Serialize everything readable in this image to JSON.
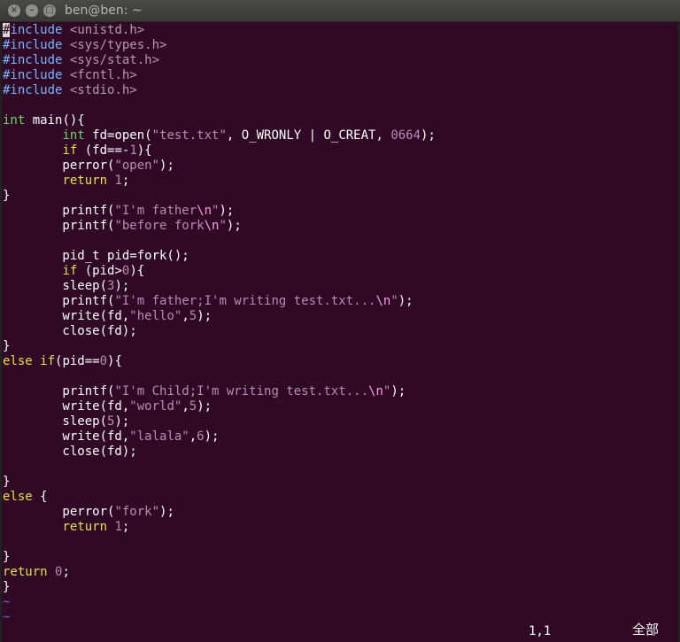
{
  "window": {
    "title": "ben@ben: ~",
    "close_glyph": "×",
    "minimize_glyph": "–",
    "maximize_glyph": "□"
  },
  "editor": {
    "lines": [
      [
        {
          "t": "#",
          "c": "cursor"
        },
        {
          "t": "include",
          "c": "pp"
        },
        {
          "t": " "
        },
        {
          "t": "<unistd.h>",
          "c": "hdr"
        }
      ],
      [
        {
          "t": "#include",
          "c": "pp"
        },
        {
          "t": " "
        },
        {
          "t": "<sys/types.h>",
          "c": "hdr"
        }
      ],
      [
        {
          "t": "#include",
          "c": "pp"
        },
        {
          "t": " "
        },
        {
          "t": "<sys/stat.h>",
          "c": "hdr"
        }
      ],
      [
        {
          "t": "#include",
          "c": "pp"
        },
        {
          "t": " "
        },
        {
          "t": "<fcntl.h>",
          "c": "hdr"
        }
      ],
      [
        {
          "t": "#include",
          "c": "pp"
        },
        {
          "t": " "
        },
        {
          "t": "<stdio.h>",
          "c": "hdr"
        }
      ],
      [],
      [
        {
          "t": "int",
          "c": "ty"
        },
        {
          "t": " main(){"
        }
      ],
      [
        {
          "t": "        "
        },
        {
          "t": "int",
          "c": "ty"
        },
        {
          "t": " fd=open("
        },
        {
          "t": "\"test.txt\"",
          "c": "str"
        },
        {
          "t": ", O_WRONLY | O_CREAT, "
        },
        {
          "t": "0664",
          "c": "num"
        },
        {
          "t": ");"
        }
      ],
      [
        {
          "t": "        "
        },
        {
          "t": "if",
          "c": "kw"
        },
        {
          "t": " (fd==-"
        },
        {
          "t": "1",
          "c": "num"
        },
        {
          "t": "){"
        }
      ],
      [
        {
          "t": "        perror("
        },
        {
          "t": "\"open\"",
          "c": "str"
        },
        {
          "t": ");"
        }
      ],
      [
        {
          "t": "        "
        },
        {
          "t": "return",
          "c": "kw"
        },
        {
          "t": " "
        },
        {
          "t": "1",
          "c": "num"
        },
        {
          "t": ";"
        }
      ],
      [
        {
          "t": "}"
        }
      ],
      [
        {
          "t": "        printf("
        },
        {
          "t": "\"I'm father",
          "c": "str"
        },
        {
          "t": "\\n",
          "c": "esc"
        },
        {
          "t": "\"",
          "c": "str"
        },
        {
          "t": ");"
        }
      ],
      [
        {
          "t": "        printf("
        },
        {
          "t": "\"before fork",
          "c": "str"
        },
        {
          "t": "\\n",
          "c": "esc"
        },
        {
          "t": "\"",
          "c": "str"
        },
        {
          "t": ");"
        }
      ],
      [],
      [
        {
          "t": "        pid_t pid=fork();"
        }
      ],
      [
        {
          "t": "        "
        },
        {
          "t": "if",
          "c": "kw"
        },
        {
          "t": " (pid>"
        },
        {
          "t": "0",
          "c": "num"
        },
        {
          "t": "){"
        }
      ],
      [
        {
          "t": "        sleep("
        },
        {
          "t": "3",
          "c": "num"
        },
        {
          "t": ");"
        }
      ],
      [
        {
          "t": "        printf("
        },
        {
          "t": "\"I'm father;I'm writing test.txt...",
          "c": "str"
        },
        {
          "t": "\\n",
          "c": "esc"
        },
        {
          "t": "\"",
          "c": "str"
        },
        {
          "t": ");"
        }
      ],
      [
        {
          "t": "        write(fd,"
        },
        {
          "t": "\"hello\"",
          "c": "str"
        },
        {
          "t": ","
        },
        {
          "t": "5",
          "c": "num"
        },
        {
          "t": ");"
        }
      ],
      [
        {
          "t": "        close(fd);"
        }
      ],
      [
        {
          "t": "}"
        }
      ],
      [
        {
          "t": "else",
          "c": "kw"
        },
        {
          "t": " "
        },
        {
          "t": "if",
          "c": "kw"
        },
        {
          "t": "(pid=="
        },
        {
          "t": "0",
          "c": "num"
        },
        {
          "t": "){"
        }
      ],
      [],
      [
        {
          "t": "        printf("
        },
        {
          "t": "\"I'm Child;I'm writing test.txt...",
          "c": "str"
        },
        {
          "t": "\\n",
          "c": "esc"
        },
        {
          "t": "\"",
          "c": "str"
        },
        {
          "t": ");"
        }
      ],
      [
        {
          "t": "        write(fd,"
        },
        {
          "t": "\"world\"",
          "c": "str"
        },
        {
          "t": ","
        },
        {
          "t": "5",
          "c": "num"
        },
        {
          "t": ");"
        }
      ],
      [
        {
          "t": "        sleep("
        },
        {
          "t": "5",
          "c": "num"
        },
        {
          "t": ");"
        }
      ],
      [
        {
          "t": "        write(fd,"
        },
        {
          "t": "\"lalala\"",
          "c": "str"
        },
        {
          "t": ","
        },
        {
          "t": "6",
          "c": "num"
        },
        {
          "t": ");"
        }
      ],
      [
        {
          "t": "        close(fd);"
        }
      ],
      [],
      [
        {
          "t": "}"
        }
      ],
      [
        {
          "t": "else",
          "c": "kw"
        },
        {
          "t": " {"
        }
      ],
      [
        {
          "t": "        perror("
        },
        {
          "t": "\"fork\"",
          "c": "str"
        },
        {
          "t": ");"
        }
      ],
      [
        {
          "t": "        "
        },
        {
          "t": "return",
          "c": "kw"
        },
        {
          "t": " "
        },
        {
          "t": "1",
          "c": "num"
        },
        {
          "t": ";"
        }
      ],
      [],
      [
        {
          "t": "}"
        }
      ],
      [
        {
          "t": "return",
          "c": "kw"
        },
        {
          "t": " "
        },
        {
          "t": "0",
          "c": "num"
        },
        {
          "t": ";"
        }
      ],
      [
        {
          "t": "}"
        }
      ],
      [
        {
          "t": "~",
          "c": "tilde"
        }
      ],
      [
        {
          "t": "~",
          "c": "tilde"
        }
      ]
    ]
  },
  "status": {
    "cursor_position": "1,1",
    "scroll_indicator": "全部"
  }
}
